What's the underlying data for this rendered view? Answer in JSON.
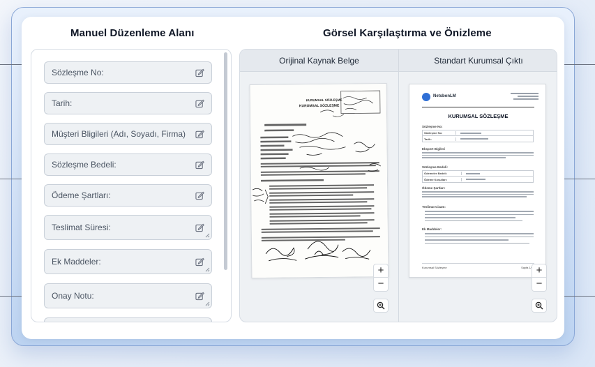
{
  "left": {
    "title": "Manuel Düzenleme Alanı",
    "fields": [
      {
        "placeholder": "Sözleşme No:"
      },
      {
        "placeholder": "Tarih:"
      },
      {
        "placeholder": "Müşteri Bligileri (Adı, Soyadı, Firma)"
      },
      {
        "placeholder": "Sözleşme Bedeli:"
      },
      {
        "placeholder": "Ödeme Şartları:"
      },
      {
        "placeholder": "Teslimat Süresi:"
      },
      {
        "placeholder": "Ek Maddeler:"
      },
      {
        "placeholder": "Onay Notu:"
      }
    ]
  },
  "right": {
    "title": "Görsel Karşılaştırma ve Önizleme",
    "original": {
      "label": "Orijinal Kaynak Belge"
    },
    "output": {
      "label": "Standart Kurumsal Çıktı"
    }
  },
  "zoom": {
    "plus": "+",
    "minus": "−"
  },
  "original_doc": {
    "heading_1": "KURUMSAL SÖZLEŞME",
    "heading_2": "KURUMSAL SÖZLEŞME"
  },
  "output_doc": {
    "brand": "NetsbonLM",
    "title": "KURUMSAL SÖZLEŞME",
    "sections": [
      {
        "title": "Sözleşme No:"
      },
      {
        "title": "Ekspert Bigileri"
      },
      {
        "title": "Sözleşme Bedeli:"
      },
      {
        "title": "Ödeme Şartları:"
      },
      {
        "title": "Teslimat Cizam:"
      },
      {
        "title": "Ek Maddeler:"
      }
    ],
    "table_rows": [
      "Sözleşme No:",
      "Tarih:",
      "Ödemeler Bedeli:",
      "Ödeme Koşulları:"
    ],
    "footer_left": "Kurumsal Sözleşme",
    "footer_right": "Sayfa 1/1"
  }
}
